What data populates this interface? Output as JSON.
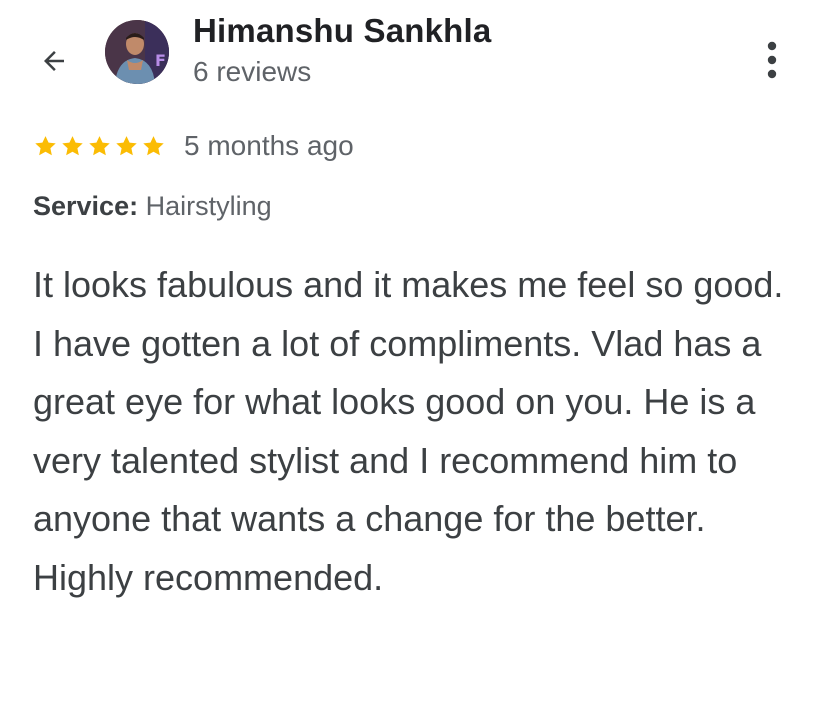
{
  "header": {
    "back_icon": "arrow-back-icon",
    "avatar_icon": "reviewer-avatar",
    "reviewer_name": "Himanshu Sankhla",
    "review_count": "6 reviews",
    "more_icon": "more-vert-icon"
  },
  "rating": {
    "stars": 5,
    "max_stars": 5,
    "star_color": "#fbbc04",
    "time_ago": "5 months ago"
  },
  "service": {
    "label": "Service:",
    "value": "Hairstyling"
  },
  "review": {
    "text": "It looks fabulous and it makes me feel so good. I have gotten a lot of compliments. Vlad has a great eye for what looks good on you. He is a very talented stylist and I recommend him to anyone that wants a change for the better. Highly recommended."
  }
}
